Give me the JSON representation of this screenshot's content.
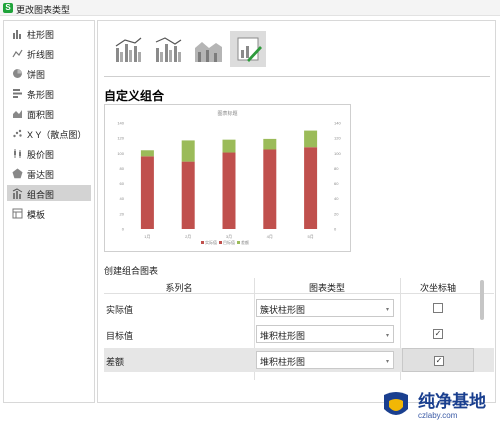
{
  "window": {
    "title": "更改图表类型",
    "app_icon_glyph": "S"
  },
  "sidebar": {
    "items": [
      {
        "label": "柱形图",
        "icon": "column-chart-icon"
      },
      {
        "label": "折线图",
        "icon": "line-chart-icon"
      },
      {
        "label": "饼图",
        "icon": "pie-chart-icon"
      },
      {
        "label": "条形图",
        "icon": "bar-chart-icon"
      },
      {
        "label": "面积图",
        "icon": "area-chart-icon"
      },
      {
        "label": "X Y（散点图）",
        "icon": "scatter-chart-icon"
      },
      {
        "label": "股价图",
        "icon": "stock-chart-icon"
      },
      {
        "label": "雷达图",
        "icon": "radar-chart-icon"
      },
      {
        "label": "组合图",
        "icon": "combo-chart-icon",
        "active": true
      },
      {
        "label": "模板",
        "icon": "template-icon"
      }
    ]
  },
  "main": {
    "heading": "自定义组合",
    "section_label": "创建组合图表",
    "table": {
      "headers": [
        "系列名",
        "图表类型",
        "次坐标轴"
      ],
      "rows": [
        {
          "name": "实际值",
          "type": "簇状柱形图",
          "secondary": false
        },
        {
          "name": "目标值",
          "type": "堆积柱形图",
          "secondary": true
        },
        {
          "name": "差额",
          "type": "堆积柱形图",
          "secondary": true
        }
      ]
    },
    "check_glyph": "✓",
    "arrow_glyph": "▾"
  },
  "chart_data": {
    "type": "bar",
    "title": "图表标题",
    "categories": [
      "1月",
      "2月",
      "3月",
      "4月",
      "5月"
    ],
    "series": [
      {
        "name": "实际值",
        "values": [
          96,
          89,
          101,
          105,
          108
        ],
        "color": "#c0504d"
      },
      {
        "name": "目标值",
        "values": [
          0,
          0,
          0,
          0,
          0
        ],
        "color": "#c0504d"
      },
      {
        "name": "差额",
        "values": [
          8,
          28,
          17,
          14,
          22
        ],
        "color": "#9bbb59"
      }
    ],
    "y_left": {
      "min": 0,
      "max": 140,
      "ticks": [
        0,
        20,
        40,
        60,
        80,
        100,
        120,
        140
      ]
    },
    "y_right": {
      "min": 0,
      "max": 140,
      "ticks": [
        0,
        20,
        40,
        60,
        80,
        100,
        120,
        140
      ]
    },
    "legend_position": "bottom",
    "grid": false
  },
  "watermark": {
    "text": "纯净基地",
    "url": "czlaby.com"
  },
  "colors": {
    "accent_green": "#1fa33a",
    "bar_red": "#c0504d",
    "bar_green": "#9bbb59",
    "wm_blue": "#1a3f8f"
  }
}
